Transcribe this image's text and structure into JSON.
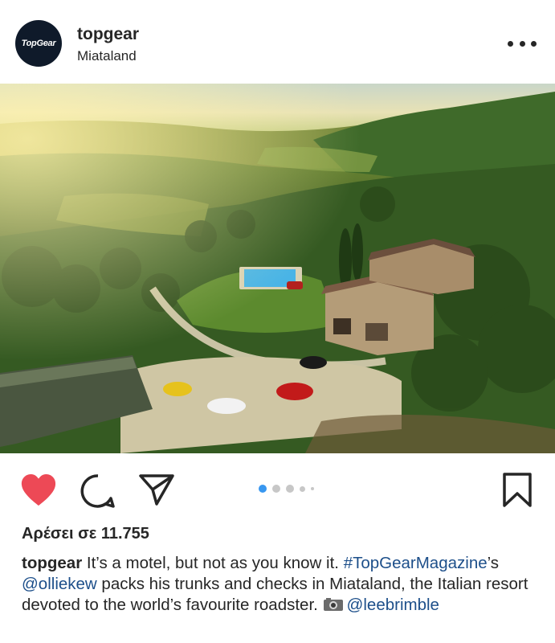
{
  "post": {
    "username": "topgear",
    "location": "Miataland",
    "avatar_text": "TopGear"
  },
  "carousel": {
    "count": 5,
    "active_index": 0
  },
  "likes_text": "Αρέσει σε 11.755",
  "caption": {
    "username": "topgear",
    "text_1": " It’s a motel, but not as you know it. ",
    "hashtag": "#TopGearMagazine",
    "text_2": "’s ",
    "mention_1": "@olliekew",
    "text_3": " packs his trunks and checks in Miataland, the Italian resort devoted to the world’s favourite roadster. ",
    "mention_2": "@leebrimble"
  },
  "colors": {
    "heart": "#ed4956",
    "link": "#1d4f8a",
    "dot_active": "#3897f0",
    "dot_inactive": "#c7c7c7"
  },
  "icons": [
    "more-icon",
    "heart-icon",
    "comment-icon",
    "share-icon",
    "bookmark-icon",
    "camera-icon"
  ]
}
